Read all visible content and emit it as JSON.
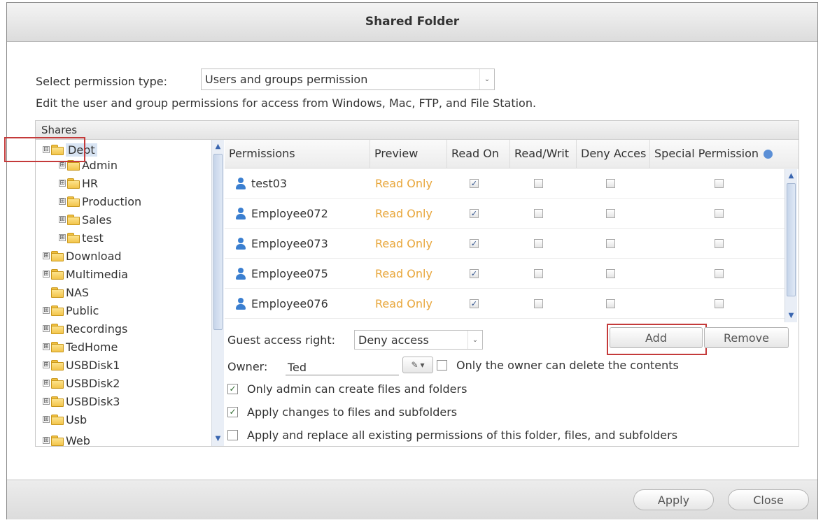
{
  "dialog": {
    "title": "Shared Folder"
  },
  "permission": {
    "label": "Select permission type:",
    "value": "Users and groups permission",
    "description": "Edit the user and group permissions for access from Windows, Mac, FTP, and File Station."
  },
  "shares": {
    "header": "Shares",
    "items": [
      {
        "label": "Dept",
        "expander": "⊟"
      },
      {
        "label": "Admin",
        "expander": "⊞"
      },
      {
        "label": "HR",
        "expander": "⊞"
      },
      {
        "label": "Production",
        "expander": "⊞"
      },
      {
        "label": "Sales",
        "expander": "⊞"
      },
      {
        "label": "test",
        "expander": "⊞"
      },
      {
        "label": "Download",
        "expander": "⊞"
      },
      {
        "label": "Multimedia",
        "expander": "⊞"
      },
      {
        "label": "NAS",
        "expander": ""
      },
      {
        "label": "Public",
        "expander": "⊞"
      },
      {
        "label": "Recordings",
        "expander": "⊞"
      },
      {
        "label": "TedHome",
        "expander": "⊞"
      },
      {
        "label": "USBDisk1",
        "expander": "⊞"
      },
      {
        "label": "USBDisk2",
        "expander": "⊞"
      },
      {
        "label": "USBDisk3",
        "expander": "⊞"
      },
      {
        "label": "Usb",
        "expander": "⊞"
      },
      {
        "label": "Web",
        "expander": "⊞"
      }
    ]
  },
  "grid": {
    "columns": [
      "Permissions",
      "Preview",
      "Read On",
      "Read/Writ",
      "Deny Acces",
      "Special Permission"
    ],
    "rows": [
      {
        "name": "test03",
        "preview": "Read Only",
        "read_only": true,
        "read_write": false,
        "deny": false,
        "special": false
      },
      {
        "name": "Employee072",
        "preview": "Read Only",
        "read_only": true,
        "read_write": false,
        "deny": false,
        "special": false
      },
      {
        "name": "Employee073",
        "preview": "Read Only",
        "read_only": true,
        "read_write": false,
        "deny": false,
        "special": false
      },
      {
        "name": "Employee075",
        "preview": "Read Only",
        "read_only": true,
        "read_write": false,
        "deny": false,
        "special": false
      },
      {
        "name": "Employee076",
        "preview": "Read Only",
        "read_only": true,
        "read_write": false,
        "deny": false,
        "special": false
      }
    ]
  },
  "guest": {
    "label": "Guest access right:",
    "value": "Deny access"
  },
  "buttons": {
    "add": "Add",
    "remove": "Remove",
    "apply": "Apply",
    "close": "Close"
  },
  "owner": {
    "label": "Owner:",
    "value": "Ted",
    "only_owner_delete": "Only the owner can delete the contents"
  },
  "options": {
    "admin_create": "Only admin can create files and folders",
    "apply_changes": "Apply changes to files and subfolders",
    "apply_replace": "Apply and replace all existing permissions of this folder, files, and subfolders"
  },
  "colors": {
    "highlight": "#c43a3a",
    "preview_text": "#e8a63a",
    "user_icon": "#3b7fd0"
  }
}
